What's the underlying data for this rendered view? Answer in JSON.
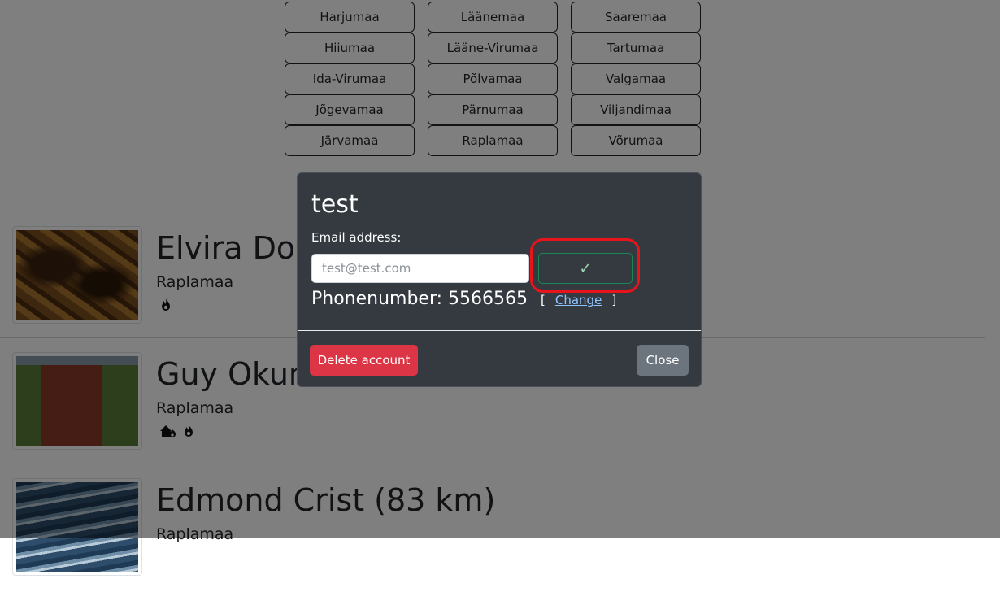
{
  "regions": [
    "Harjumaa",
    "Läänemaa",
    "Saaremaa",
    "Hiiumaa",
    "Lääne-Virumaa",
    "Tartumaa",
    "Ida-Virumaa",
    "Põlvamaa",
    "Valgamaa",
    "Jõgevamaa",
    "Pärnumaa",
    "Viljandimaa",
    "Järvamaa",
    "Raplamaa",
    "Võrumaa"
  ],
  "listings": [
    {
      "name": "Elvira Doy",
      "county": "Raplamaa",
      "icons": [
        "fire-icon"
      ]
    },
    {
      "name": "Guy Okun",
      "county": "Raplamaa",
      "icons": [
        "house-fire-icon",
        "fire-icon"
      ]
    },
    {
      "name": "Edmond Crist (83 km)",
      "county": "Raplamaa",
      "icons": []
    }
  ],
  "modal": {
    "title": "test",
    "email_label": "Email address:",
    "email_placeholder": "test@test.com",
    "confirm_symbol": "✓",
    "phone_text": "Phonenumber: 5566565",
    "bracket_open": "[",
    "change_label": "Change",
    "bracket_close": "]",
    "delete_label": "Delete account",
    "close_label": "Close"
  },
  "colors": {
    "modal_bg": "#343a40",
    "danger": "#dc3545",
    "secondary": "#6c757d",
    "success_outline": "#198754",
    "highlight": "#e8141c",
    "link": "#8ec5ff"
  }
}
